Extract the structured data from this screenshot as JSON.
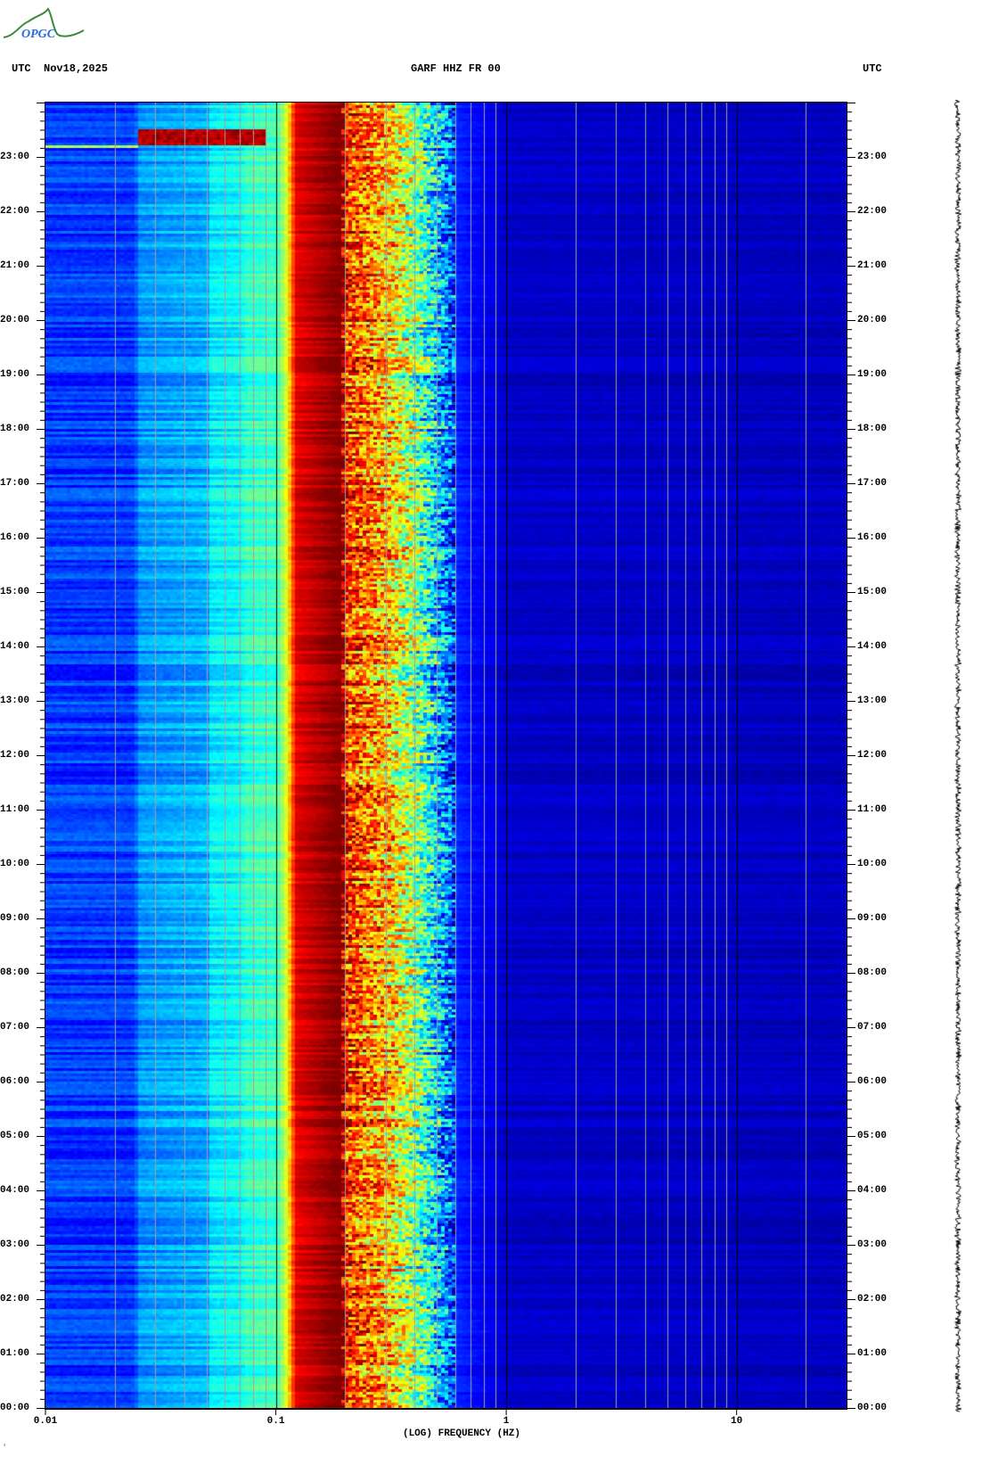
{
  "header": {
    "left_tz": "UTC",
    "date": "Nov18,2025",
    "station": "GARF HHZ FR 00",
    "right_tz": "UTC"
  },
  "logo": {
    "text": "OPGC",
    "color": "#3a8a3a",
    "text_color": "#2a6ae0"
  },
  "footer_mark": "′",
  "chart_data": {
    "type": "heatmap",
    "title": "GARF HHZ FR 00",
    "xlabel": "(LOG) FREQUENCY (HZ)",
    "ylabel": "UTC",
    "x_scale": "log",
    "xlim": [
      0.01,
      30
    ],
    "ylim_hours": [
      0,
      24
    ],
    "x_tick_values": [
      0.01,
      0.1,
      1,
      10
    ],
    "x_tick_labels": [
      "0.01",
      "0.1",
      "1",
      "10"
    ],
    "y_tick_labels": [
      "00:00",
      "01:00",
      "02:00",
      "03:00",
      "04:00",
      "05:00",
      "06:00",
      "07:00",
      "08:00",
      "09:00",
      "10:00",
      "11:00",
      "12:00",
      "13:00",
      "14:00",
      "15:00",
      "16:00",
      "17:00",
      "18:00",
      "19:00",
      "20:00",
      "21:00",
      "22:00",
      "23:00"
    ],
    "y_minor_tick_minutes": 10,
    "gridline_frequencies": [
      0.02,
      0.03,
      0.04,
      0.05,
      0.06,
      0.07,
      0.08,
      0.09,
      0.1,
      0.2,
      0.3,
      0.4,
      0.5,
      0.6,
      0.7,
      0.8,
      0.9,
      1,
      2,
      3,
      4,
      5,
      6,
      7,
      8,
      9,
      10,
      20
    ],
    "colormap": "jet",
    "mean_level_profile": [
      {
        "freq_hz": 0.01,
        "level": 0.18
      },
      {
        "freq_hz": 0.024,
        "level": 0.18
      },
      {
        "freq_hz": 0.025,
        "level": 0.27
      },
      {
        "freq_hz": 0.05,
        "level": 0.3
      },
      {
        "freq_hz": 0.051,
        "level": 0.36
      },
      {
        "freq_hz": 0.07,
        "level": 0.38
      },
      {
        "freq_hz": 0.072,
        "level": 0.42
      },
      {
        "freq_hz": 0.1,
        "level": 0.44
      },
      {
        "freq_hz": 0.11,
        "level": 0.6
      },
      {
        "freq_hz": 0.12,
        "level": 0.9
      },
      {
        "freq_hz": 0.19,
        "level": 1.0
      },
      {
        "freq_hz": 0.2,
        "level": 0.82
      },
      {
        "freq_hz": 0.3,
        "level": 0.68
      },
      {
        "freq_hz": 0.4,
        "level": 0.5
      },
      {
        "freq_hz": 0.5,
        "level": 0.32
      },
      {
        "freq_hz": 0.6,
        "level": 0.16
      },
      {
        "freq_hz": 1,
        "level": 0.07
      },
      {
        "freq_hz": 30,
        "level": 0.06
      }
    ],
    "events": [
      {
        "start_hour": 23.25,
        "end_hour": 23.55,
        "freq_range_hz": [
          0.025,
          0.09
        ],
        "level": 0.95
      },
      {
        "start_hour": 23.18,
        "end_hour": 23.25,
        "freq_range_hz": [
          0.01,
          0.025
        ],
        "level": 0.55
      }
    ]
  }
}
